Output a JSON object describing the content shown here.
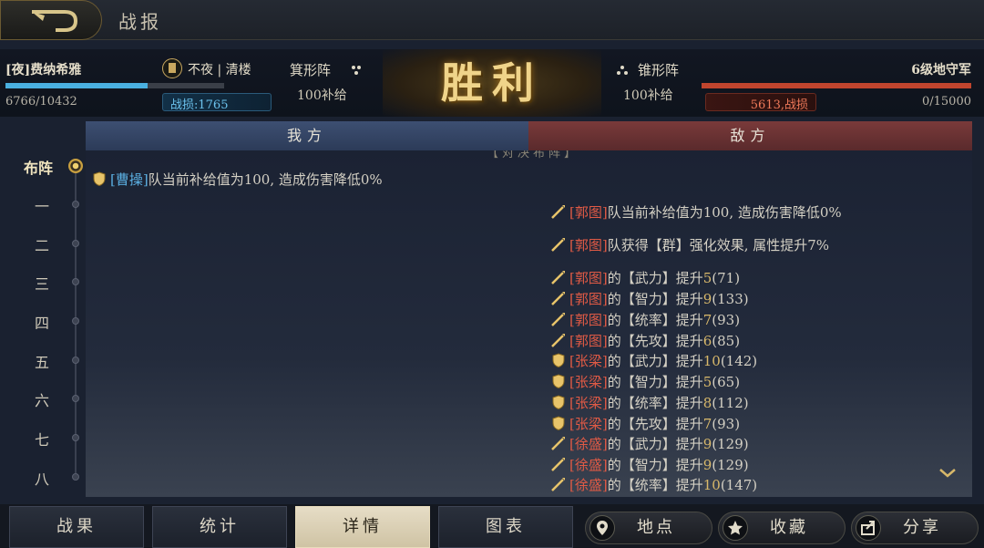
{
  "topbar": {
    "title": "战报"
  },
  "ours": {
    "team_name": "[夜]费纳希雅",
    "hp": "6766/10432",
    "hp_fraction": 0.648,
    "faction": "不夜 | 清楼",
    "loss": "战损:1765",
    "formation": "箕形阵",
    "supply": "100补给"
  },
  "result": "胜利",
  "enemy": {
    "team_name": "6级地守军",
    "hp": "0/15000",
    "hp_fraction": 1.0,
    "loss": "5613,战损",
    "formation": "锥形阵",
    "supply": "100补给"
  },
  "side_tabs": {
    "ours": "我方",
    "enemy": "敌方"
  },
  "timeline": [
    "布阵",
    "一",
    "二",
    "三",
    "四",
    "五",
    "六",
    "七",
    "八"
  ],
  "log_header": "【对决布阵】",
  "log": [
    {
      "side": "ours",
      "icon": "shield",
      "hero": "[曹操]",
      "text": "队当前补给值为100, 造成伤害降低0%"
    },
    {
      "side": "enemy",
      "icon": "spear",
      "hero": "[郭图]",
      "text": "队当前补给值为100, 造成伤害降低0%"
    },
    {
      "side": "enemy",
      "icon": "spear",
      "hero": "[郭图]",
      "text": "队获得【群】强化效果, 属性提升7%"
    },
    {
      "side": "enemy",
      "icon": "spear",
      "hero": "[郭图]",
      "text": "的【武力】提升",
      "num": "5",
      "tail": "(71)"
    },
    {
      "side": "enemy",
      "icon": "spear",
      "hero": "[郭图]",
      "text": "的【智力】提升",
      "num": "9",
      "tail": "(133)"
    },
    {
      "side": "enemy",
      "icon": "spear",
      "hero": "[郭图]",
      "text": "的【统率】提升",
      "num": "7",
      "tail": "(93)"
    },
    {
      "side": "enemy",
      "icon": "spear",
      "hero": "[郭图]",
      "text": "的【先攻】提升",
      "num": "6",
      "tail": "(85)"
    },
    {
      "side": "enemy",
      "icon": "shield",
      "hero": "[张梁]",
      "text": "的【武力】提升",
      "num": "10",
      "tail": "(142)"
    },
    {
      "side": "enemy",
      "icon": "shield",
      "hero": "[张梁]",
      "text": "的【智力】提升",
      "num": "5",
      "tail": "(65)"
    },
    {
      "side": "enemy",
      "icon": "shield",
      "hero": "[张梁]",
      "text": "的【统率】提升",
      "num": "8",
      "tail": "(112)"
    },
    {
      "side": "enemy",
      "icon": "shield",
      "hero": "[张梁]",
      "text": "的【先攻】提升",
      "num": "7",
      "tail": "(93)"
    },
    {
      "side": "enemy",
      "icon": "spear",
      "hero": "[徐盛]",
      "text": "的【武力】提升",
      "num": "9",
      "tail": "(129)"
    },
    {
      "side": "enemy",
      "icon": "spear",
      "hero": "[徐盛]",
      "text": "的【智力】提升",
      "num": "9",
      "tail": "(129)"
    },
    {
      "side": "enemy",
      "icon": "spear",
      "hero": "[徐盛]",
      "text": "的【统率】提升",
      "num": "10",
      "tail": "(147)"
    }
  ],
  "bottom_tabs": [
    "战果",
    "统计",
    "详情",
    "图表"
  ],
  "active_tab": "详情",
  "actions": [
    {
      "label": "地点",
      "icon": "location-pin-icon"
    },
    {
      "label": "收藏",
      "icon": "star-icon"
    },
    {
      "label": "分享",
      "icon": "share-icon"
    }
  ],
  "colors": {
    "accent_gold": "#f0d48a",
    "ours_blue": "#4ab0e0",
    "enemy_red": "#c0452e"
  }
}
